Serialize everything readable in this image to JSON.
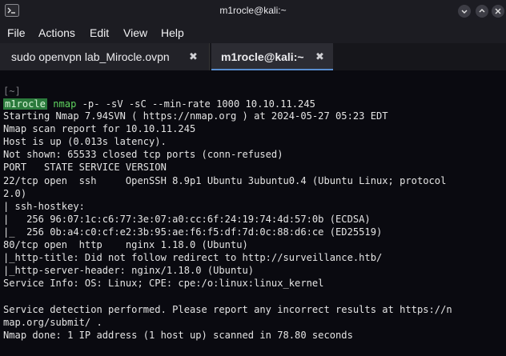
{
  "window": {
    "title": "m1rocle@kali:~",
    "minimize_icon": "minimize-icon",
    "maximize_icon": "maximize-icon",
    "close_icon": "close-icon"
  },
  "menu": {
    "file": "File",
    "actions": "Actions",
    "edit": "Edit",
    "view": "View",
    "help": "Help"
  },
  "tabs": [
    {
      "label": "sudo openvpn lab_Mirocle.ovpn",
      "close": "✖"
    },
    {
      "label": "m1rocle@kali:~",
      "close": "✖"
    }
  ],
  "terminal": {
    "prompt_dir": "[~]",
    "prompt_user": "m1rocle",
    "command": "nmap",
    "command_args": " -p- -sV -sC --min-rate 1000 10.10.11.245",
    "lines": [
      "Starting Nmap 7.94SVN ( https://nmap.org ) at 2024-05-27 05:23 EDT",
      "Nmap scan report for 10.10.11.245",
      "Host is up (0.013s latency).",
      "Not shown: 65533 closed tcp ports (conn-refused)",
      "PORT   STATE SERVICE VERSION",
      "22/tcp open  ssh     OpenSSH 8.9p1 Ubuntu 3ubuntu0.4 (Ubuntu Linux; protocol",
      "2.0)",
      "| ssh-hostkey:",
      "|   256 96:07:1c:c6:77:3e:07:a0:cc:6f:24:19:74:4d:57:0b (ECDSA)",
      "|_  256 0b:a4:c0:cf:e2:3b:95:ae:f6:f5:df:7d:0c:88:d6:ce (ED25519)",
      "80/tcp open  http    nginx 1.18.0 (Ubuntu)",
      "|_http-title: Did not follow redirect to http://surveillance.htb/",
      "|_http-server-header: nginx/1.18.0 (Ubuntu)",
      "Service Info: OS: Linux; CPE: cpe:/o:linux:linux_kernel",
      "",
      "Service detection performed. Please report any incorrect results at https://n",
      "map.org/submit/ .",
      "Nmap done: 1 IP address (1 host up) scanned in 78.80 seconds"
    ]
  }
}
